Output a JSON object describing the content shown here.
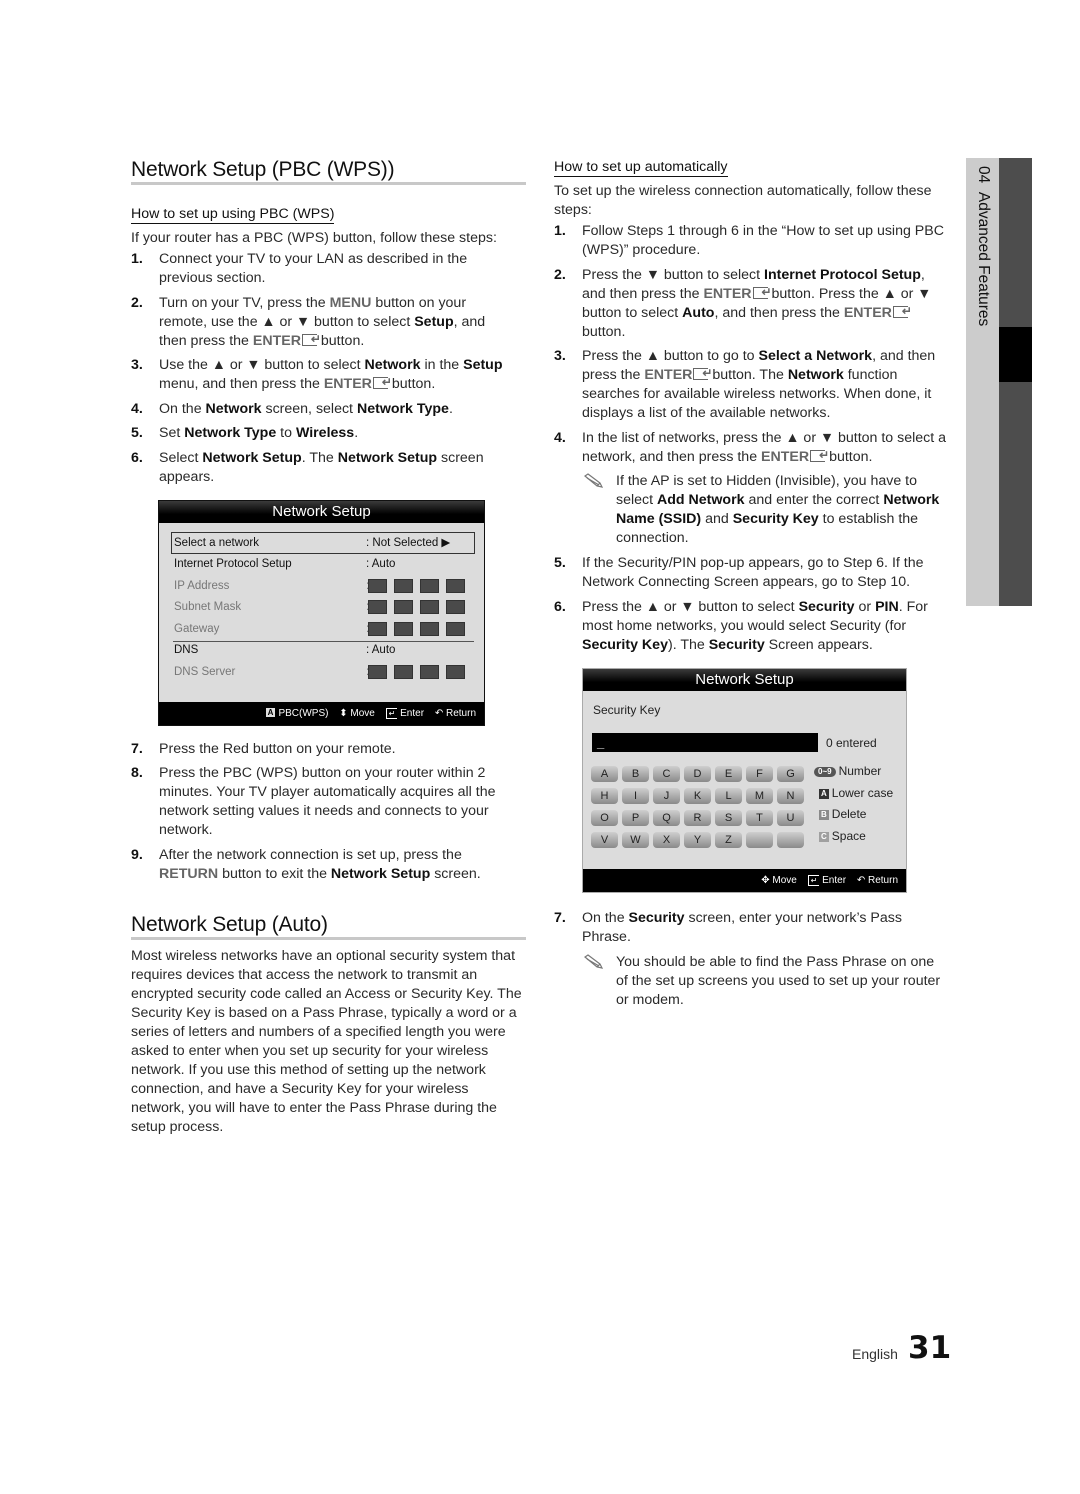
{
  "left_column": {
    "pbc_section": {
      "title": "Network Setup (PBC (WPS))",
      "subtitle": "How to set up using PBC (WPS)",
      "intro": "If your router has a PBC (WPS) button, follow these steps:",
      "steps": [
        {
          "num": "1.",
          "html": "Connect your TV to your LAN as described in the previous section."
        },
        {
          "num": "2.",
          "html": "Turn on your TV, press the <b class='r'>MENU</b> button on your remote, use the ▲ or ▼ button to select <b class='k'>Setup</b>, and then press the <b class='r'>ENTER</b><span class='enter-glyph'></span> button."
        },
        {
          "num": "3.",
          "html": "Use the ▲ or ▼ button to select <b class='k'>Network</b> in the <b class='k'>Setup</b> menu, and then press the <b class='r'>ENTER</b><span class='enter-glyph'></span> button."
        },
        {
          "num": "4.",
          "html": "On the <b class='k'>Network</b> screen, select <b class='k'>Network Type</b>."
        },
        {
          "num": "5.",
          "html": "Set <b class='k'>Network Type</b> to <b class='k'>Wireless</b>."
        },
        {
          "num": "6.",
          "html": "Select <b class='k'>Network Setup</b>. The <b class='k'>Network Setup</b> screen appears."
        },
        {
          "num": "7.",
          "html": "Press the Red button on your remote."
        },
        {
          "num": "8.",
          "html": "Press the PBC (WPS) button on your router within 2 minutes. Your TV player automatically acquires all the network setting values it needs and connects to your network."
        },
        {
          "num": "9.",
          "html": "After the network connection is set up, press the <b class='r'>RETURN</b> button to exit the <b class='k'>Network Setup</b> screen."
        }
      ]
    },
    "auto_section": {
      "title": "Network Setup (Auto)",
      "body": "Most wireless networks have an optional security system that requires devices that access the network to transmit an encrypted security code called an Access or Security Key. The Security Key is based on a Pass Phrase, typically a word or a series of letters and numbers of a specified length you were asked to enter when you set up security for your wireless network. If you use this method of setting up the network connection, and have a Security Key for your wireless network, you will have to enter the Pass Phrase during the setup process."
    }
  },
  "network_setup_screen": {
    "title": "Network Setup",
    "rows": [
      {
        "label": "Select a network",
        "value": ": Not Selected",
        "arrow": "▶",
        "selected": true
      },
      {
        "label": "Internet Protocol Setup",
        "value": ": Auto"
      },
      {
        "label": "IP Address",
        "value": ":",
        "blocks": 4
      },
      {
        "label": "Subnet Mask",
        "value": ":",
        "blocks": 4
      },
      {
        "label": "Gateway",
        "value": ":",
        "blocks": 4
      },
      {
        "label": "DNS",
        "value": ": Auto"
      },
      {
        "label": "DNS Server",
        "value": ":",
        "blocks": 4
      }
    ],
    "footer": {
      "pbc_badge": "A",
      "pbc": "PBC(WPS)",
      "move_icon": "up-down-arrow-icon",
      "move": "Move",
      "enter_icon": "enter-icon",
      "enter": "Enter",
      "return_icon": "return-icon",
      "return": "Return"
    }
  },
  "right_column": {
    "subtitle": "How to set up automatically",
    "intro": "To set up the wireless connection automatically, follow these steps:",
    "steps": [
      {
        "num": "1.",
        "html": "Follow Steps 1 through 6 in the “How to set up using PBC (WPS)” procedure."
      },
      {
        "num": "2.",
        "html": "Press the ▼ button to select <b class='k'>Internet Protocol Setup</b>, and then press the <b class='r'>ENTER</b><span class='enter-glyph'></span> button. Press the ▲ or ▼ button to select <b class='k'>Auto</b>, and then press the <b class='r'>ENTER</b><span class='enter-glyph'></span> button."
      },
      {
        "num": "3.",
        "html": "Press the ▲ button to go to <b class='k'>Select a Network</b>, and then press the <b class='r'>ENTER</b><span class='enter-glyph'></span> button. The <b class='k'>Network</b> function searches for available wireless networks. When done, it displays a list of the available networks."
      },
      {
        "num": "4.",
        "html": "In the list of networks, press the ▲ or ▼ button to select a network, and then press the <b class='r'>ENTER</b><span class='enter-glyph'></span> button."
      },
      {
        "num": "5.",
        "html": "If the Security/PIN pop-up appears, go to Step 6. If the Network Connecting Screen appears, go to Step 10."
      },
      {
        "num": "6.",
        "html": "Press the ▲ or ▼ button to select <b class='k'>Security</b> or <b class='k'>PIN</b>. For most home networks, you would select Security (for <b class='k'>Security Key</b>). The <b class='k'>Security</b> Screen appears."
      },
      {
        "num": "7.",
        "html": "On the <b class='k'>Security</b> screen, enter your network’s Pass Phrase."
      }
    ],
    "notes": [
      {
        "icon": "pencil-note-icon",
        "html": "If the AP is set to Hidden (Invisible), you have to select <b class='k'>Add Network</b> and enter the correct <b class='k'>Network Name (SSID)</b> and <b class='k'>Security Key</b> to establish the connection."
      },
      {
        "icon": "pencil-note-icon",
        "html": "You should be able to find the Pass Phrase on one of the set up screens you used to set up your router or modem."
      }
    ]
  },
  "security_screen": {
    "title": "Network Setup",
    "field_label": "Security Key",
    "input_value": "_",
    "count_text": "0 entered",
    "keys": [
      "A",
      "B",
      "C",
      "D",
      "E",
      "F",
      "G",
      "H",
      "I",
      "J",
      "K",
      "L",
      "M",
      "N",
      "O",
      "P",
      "Q",
      "R",
      "S",
      "T",
      "U",
      "V",
      "W",
      "X",
      "Y",
      "Z",
      "",
      ""
    ],
    "legend": [
      {
        "badge": "0~9",
        "label": "Number",
        "color": "#555555"
      },
      {
        "badge": "A",
        "label": "Lower case",
        "color": "#333333"
      },
      {
        "badge": "B",
        "label": "Delete",
        "color": "#8a8a8a"
      },
      {
        "badge": "C",
        "label": "Space",
        "color": "#a0a0a0"
      }
    ],
    "footer": {
      "move_icon": "four-way-arrow-icon",
      "move": "Move",
      "enter_icon": "enter-icon",
      "enter": "Enter",
      "return_icon": "return-icon",
      "return": "Return"
    }
  },
  "side_tab": {
    "chapter": "04",
    "title": "Advanced Features"
  },
  "footer": {
    "language": "English",
    "page_number": "31"
  }
}
